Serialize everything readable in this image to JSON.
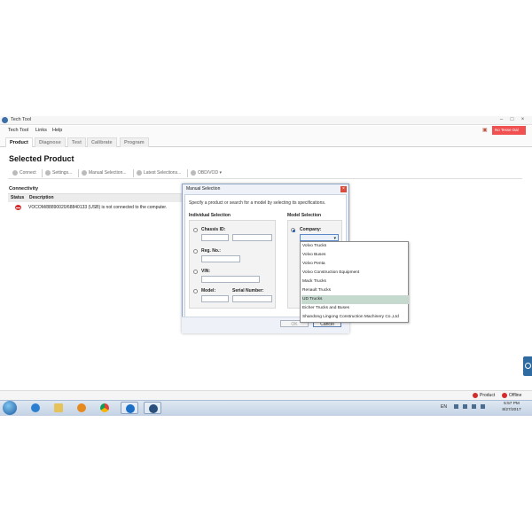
{
  "window": {
    "title": "Tech Tool",
    "minimize_icon": "–",
    "maximize_icon": "□",
    "close_icon": "×"
  },
  "menu": {
    "items": [
      "Tech Tool",
      "Links",
      "Help"
    ]
  },
  "user": {
    "label": "No Tesse Dal"
  },
  "tabs": [
    "Product",
    "Diagnose",
    "Test",
    "Calibrate",
    "Program"
  ],
  "page_title": "Selected Product",
  "toolbar": {
    "connect": "Connect",
    "settings": "Settings...",
    "manual": "Manual Selection...",
    "latest": "Latest Selections...",
    "obd": "OBD/VOD ▾"
  },
  "connectivity": {
    "heading": "Connectivity",
    "col_status": "Status",
    "col_description": "Description",
    "row_description": "VOCOM/88890020/68840133 (USB) is not connected to the computer."
  },
  "dialog": {
    "title": "Manual Selection",
    "close_icon": "×",
    "instruction": "Specify a product or search for a model by selecting its specifications.",
    "individual_title": "Individual Selection",
    "model_title": "Model Selection",
    "chassis_label": "Chassis ID:",
    "reg_label": "Reg. No.:",
    "vin_label": "VIN:",
    "model_label": "Model:",
    "serial_label": "Serial Number:",
    "company_label": "Company:",
    "select_arrow": "▾",
    "ok": "OK",
    "cancel": "Cancel"
  },
  "dropdown": {
    "options": [
      "Volvo Trucks",
      "Volvo Buses",
      "Volvo Penta",
      "Volvo Construction Equipment",
      "Mack Trucks",
      "Renault Trucks",
      "UD Trucks",
      "Eicher Trucks and Buses",
      "Shandong Lingong Construction Machinery Co.,Ltd"
    ],
    "selected_index": 6
  },
  "statusbar": {
    "product": "Product",
    "offline": "Offline"
  },
  "taskbar": {
    "lang": "EN",
    "time": "5:57 PM",
    "date": "8/27/2017"
  },
  "colors": {
    "accent": "#2a5db0",
    "error": "#d42b2b",
    "user_box": "#f05050"
  }
}
